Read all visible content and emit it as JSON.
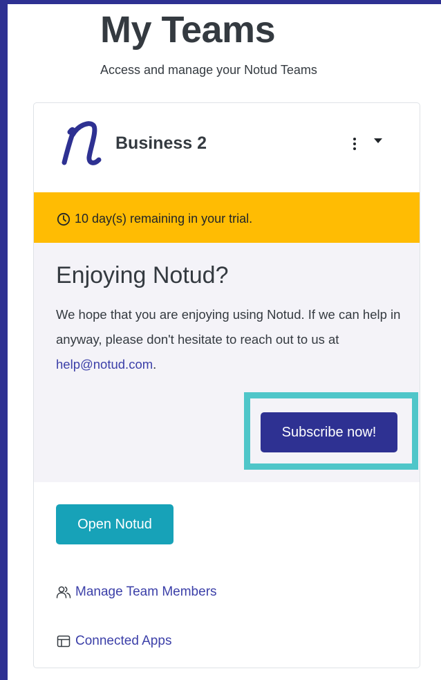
{
  "header": {
    "title": "My Teams",
    "subtitle": "Access and manage your Notud Teams"
  },
  "team": {
    "name": "Business 2",
    "logo_icon": "notud-n-logo",
    "menu_icon": "kebab-menu-icon",
    "dropdown_icon": "caret-down-icon"
  },
  "trial": {
    "message": "10 day(s) remaining in your trial.",
    "icon": "clock-icon",
    "color": "#ffbc03"
  },
  "promo": {
    "heading": "Enjoying Notud?",
    "body": "We hope that you are enjoying using Notud. If we can help in anyway, please don't hesitate to reach out to us at ",
    "email": "help@notud.com",
    "body_end": ".",
    "subscribe_label": "Subscribe now!"
  },
  "actions": {
    "open_label": "Open Notud",
    "manage_members_label": "Manage Team Members",
    "manage_members_icon": "users-icon",
    "connected_apps_label": "Connected Apps",
    "connected_apps_icon": "layout-icon"
  },
  "colors": {
    "brand": "#2e3192",
    "accent": "#17a2b8",
    "highlight": "#4fc6c9",
    "warning": "#ffbc03"
  }
}
